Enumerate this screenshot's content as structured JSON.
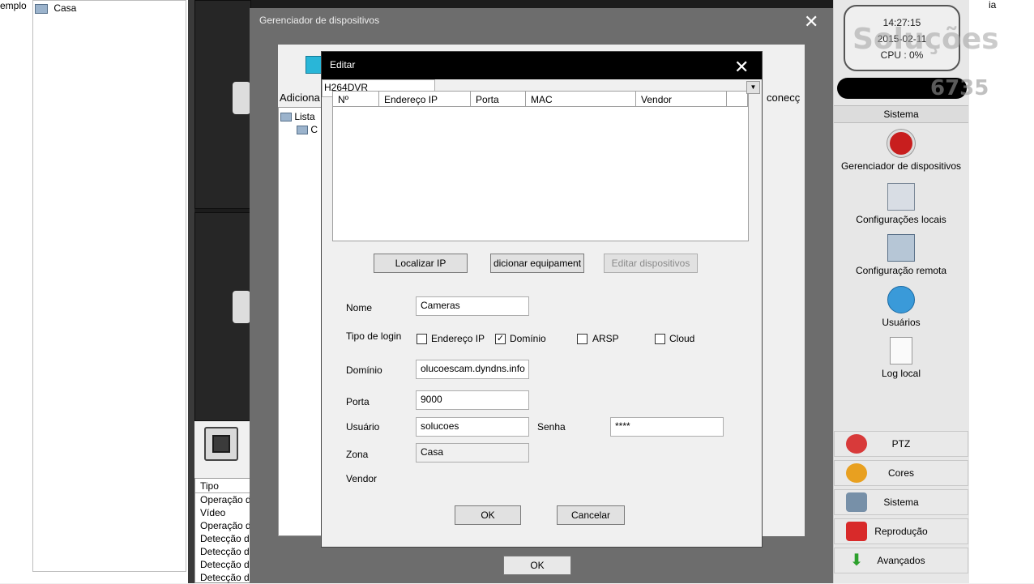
{
  "left_pane": {
    "truncated_label": "emplo",
    "tree_item": "Casa"
  },
  "log": {
    "header": "Tipo",
    "rows": [
      "Operação d",
      "Vídeo",
      "Operação d",
      "Detecção d",
      "Detecção d",
      "Detecção d",
      "Detecção d"
    ]
  },
  "device_manager": {
    "title": "Gerenciador de dispositivos",
    "close": "✕",
    "add_label": "Adiciona",
    "connect_label": "conecç",
    "tree_root": "Lista",
    "tree_child": "C",
    "ok": "OK"
  },
  "edit_dialog": {
    "title": "Editar",
    "close": "✕",
    "table_headers": [
      "Nº",
      "Endereço IP",
      "Porta",
      "MAC",
      "Vendor"
    ],
    "buttons": {
      "locate_ip": "Localizar IP",
      "add_equipment": "dicionar equipament",
      "edit_devices": "Editar dispositivos",
      "ok": "OK",
      "cancel": "Cancelar"
    },
    "labels": {
      "name": "Nome",
      "login_type": "Tipo de login",
      "domain": "Domínio",
      "port": "Porta",
      "user": "Usuário",
      "password": "Senha",
      "zone": "Zona",
      "vendor": "Vendor"
    },
    "login_options": [
      {
        "label": "Endereço IP",
        "checked": false
      },
      {
        "label": "Domínio",
        "checked": true
      },
      {
        "label": "ARSP",
        "checked": false
      },
      {
        "label": "Cloud",
        "checked": false
      }
    ],
    "values": {
      "name": "Cameras",
      "domain": "olucoescam.dyndns.info",
      "port": "9000",
      "user": "solucoes",
      "password": "****",
      "zone": "Casa",
      "vendor": "H264DVR"
    }
  },
  "right_panel": {
    "clock": {
      "time": "14:27:15",
      "date": "2015-02-11",
      "cpu": "CPU : 0%"
    },
    "watermark": "Soluções",
    "phone_partial": "6735",
    "section_title": "Sistema",
    "tools": [
      {
        "label": "Gerenciador de dispositivos",
        "icon": "device-manager-icon"
      },
      {
        "label": "Configurações locais",
        "icon": "local-config-icon"
      },
      {
        "label": "Configuração remota",
        "icon": "remote-config-icon"
      },
      {
        "label": "Usuários",
        "icon": "users-icon"
      },
      {
        "label": "Log local",
        "icon": "log-icon"
      }
    ],
    "menu": [
      {
        "label": "PTZ",
        "icon": "ptz-icon"
      },
      {
        "label": "Cores",
        "icon": "colors-icon"
      },
      {
        "label": "Sistema",
        "icon": "system-icon"
      },
      {
        "label": "Reprodução",
        "icon": "playback-icon"
      },
      {
        "label": "Avançados",
        "icon": "advanced-icon"
      }
    ]
  },
  "far_right": {
    "text": "ia"
  }
}
